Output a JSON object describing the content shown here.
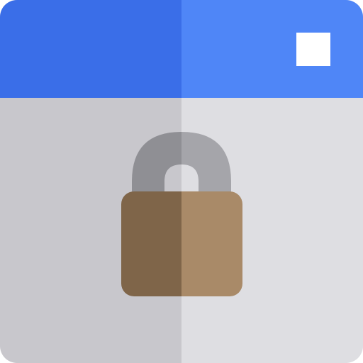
{
  "icon": {
    "name": "secure-window-icon",
    "title_bar": {
      "color_left": "#3A6EE8",
      "color_right": "#4F86F7",
      "control_icon": "window-control-square-icon",
      "control_color": "#FFFFFF"
    },
    "window_body": {
      "color_left": "#C8C7CC",
      "color_right": "#DEDEE2"
    },
    "padlock": {
      "icon": "lock-icon",
      "shackle_color_left": "#8F8F94",
      "shackle_color_right": "#A5A5AA",
      "body_color_left": "#7F6549",
      "body_color_right": "#A98A68"
    }
  }
}
